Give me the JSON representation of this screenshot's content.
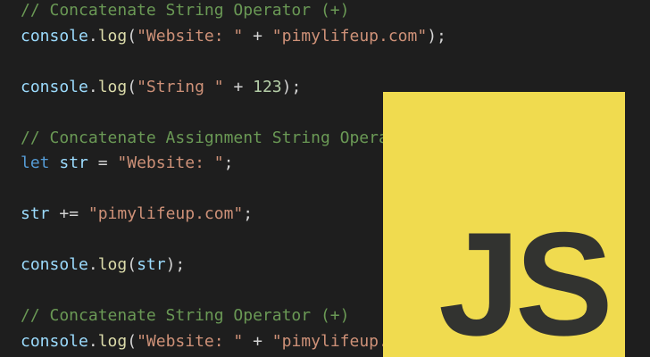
{
  "colors": {
    "background": "#1e1e1e",
    "comment": "#6a9955",
    "identifier": "#9cdcfe",
    "function": "#dcdcaa",
    "string": "#ce9178",
    "number": "#b5cea8",
    "keyword": "#569cd6",
    "punctuation": "#d4d4d4",
    "logo_background": "#f0db4f",
    "logo_text": "#323330"
  },
  "code": {
    "lines": [
      {
        "tokens": [
          {
            "t": "// Concatenate String Operator (+)",
            "k": "comment"
          }
        ]
      },
      {
        "tokens": [
          {
            "t": "console",
            "k": "ident"
          },
          {
            "t": ".",
            "k": "punct"
          },
          {
            "t": "log",
            "k": "func"
          },
          {
            "t": "(",
            "k": "punct"
          },
          {
            "t": "\"Website: \"",
            "k": "string"
          },
          {
            "t": " + ",
            "k": "punct"
          },
          {
            "t": "\"pimylifeup.com\"",
            "k": "string"
          },
          {
            "t": ");",
            "k": "punct"
          }
        ]
      },
      {
        "tokens": []
      },
      {
        "tokens": [
          {
            "t": "console",
            "k": "ident"
          },
          {
            "t": ".",
            "k": "punct"
          },
          {
            "t": "log",
            "k": "func"
          },
          {
            "t": "(",
            "k": "punct"
          },
          {
            "t": "\"String \"",
            "k": "string"
          },
          {
            "t": " + ",
            "k": "punct"
          },
          {
            "t": "123",
            "k": "number"
          },
          {
            "t": ");",
            "k": "punct"
          }
        ]
      },
      {
        "tokens": []
      },
      {
        "tokens": [
          {
            "t": "// Concatenate Assignment String Operator (+=)",
            "k": "comment"
          }
        ]
      },
      {
        "tokens": [
          {
            "t": "let",
            "k": "keyword"
          },
          {
            "t": " ",
            "k": "punct"
          },
          {
            "t": "str",
            "k": "ident"
          },
          {
            "t": " = ",
            "k": "punct"
          },
          {
            "t": "\"Website: \"",
            "k": "string"
          },
          {
            "t": ";",
            "k": "punct"
          }
        ]
      },
      {
        "tokens": []
      },
      {
        "tokens": [
          {
            "t": "str",
            "k": "ident"
          },
          {
            "t": " += ",
            "k": "punct"
          },
          {
            "t": "\"pimylifeup.com\"",
            "k": "string"
          },
          {
            "t": ";",
            "k": "punct"
          }
        ]
      },
      {
        "tokens": []
      },
      {
        "tokens": [
          {
            "t": "console",
            "k": "ident"
          },
          {
            "t": ".",
            "k": "punct"
          },
          {
            "t": "log",
            "k": "func"
          },
          {
            "t": "(",
            "k": "punct"
          },
          {
            "t": "str",
            "k": "ident"
          },
          {
            "t": ");",
            "k": "punct"
          }
        ]
      },
      {
        "tokens": []
      },
      {
        "tokens": [
          {
            "t": "// Concatenate String Operator (+)",
            "k": "comment"
          }
        ]
      },
      {
        "tokens": [
          {
            "t": "console",
            "k": "ident"
          },
          {
            "t": ".",
            "k": "punct"
          },
          {
            "t": "log",
            "k": "func"
          },
          {
            "t": "(",
            "k": "punct"
          },
          {
            "t": "\"Website: \"",
            "k": "string"
          },
          {
            "t": " + ",
            "k": "punct"
          },
          {
            "t": "\"pimylifeup.com\"",
            "k": "string"
          },
          {
            "t": ");",
            "k": "punct"
          }
        ]
      }
    ]
  },
  "logo": {
    "text": "JS",
    "icon": "javascript-logo-icon"
  }
}
